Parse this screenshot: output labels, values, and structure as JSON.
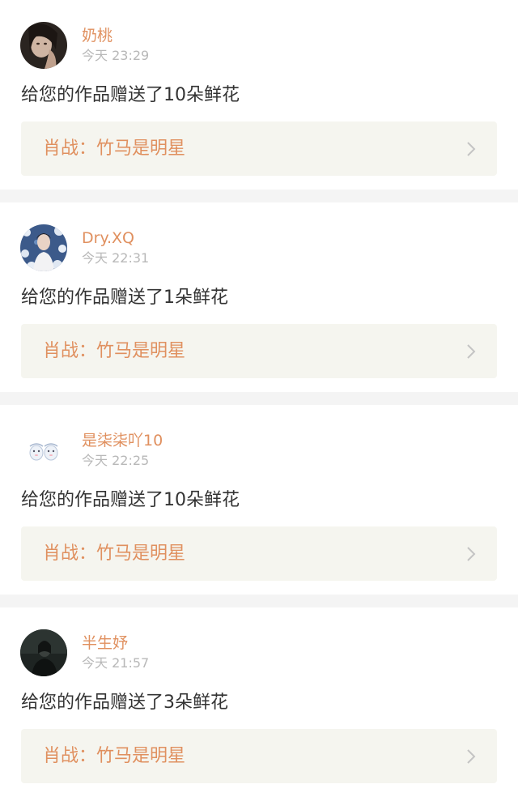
{
  "notifications": [
    {
      "username": "奶桃",
      "time": "今天 23:29",
      "message": "给您的作品赠送了10朵鲜花",
      "work_title": "肖战：竹马是明星",
      "avatar_icon": "dark-portrait-avatar"
    },
    {
      "username": "Dry.XQ",
      "time": "今天 22:31",
      "message": "给您的作品赠送了1朵鲜花",
      "work_title": "肖战：竹马是明星",
      "avatar_icon": "flower-portrait-avatar"
    },
    {
      "username": "是柒柒吖10",
      "time": "今天 22:25",
      "message": "给您的作品赠送了10朵鲜花",
      "work_title": "肖战：竹马是明星",
      "avatar_icon": "cartoon-avatar"
    },
    {
      "username": "半生妤",
      "time": "今天 21:57",
      "message": "给您的作品赠送了3朵鲜花",
      "work_title": "肖战：竹马是明星",
      "avatar_icon": "dark-figure-avatar"
    }
  ],
  "colors": {
    "accent": "#e0905f",
    "muted": "#b8b8b8",
    "text": "#333333",
    "link_bg": "#f5f5ef",
    "page_bg": "#f4f4f4"
  }
}
